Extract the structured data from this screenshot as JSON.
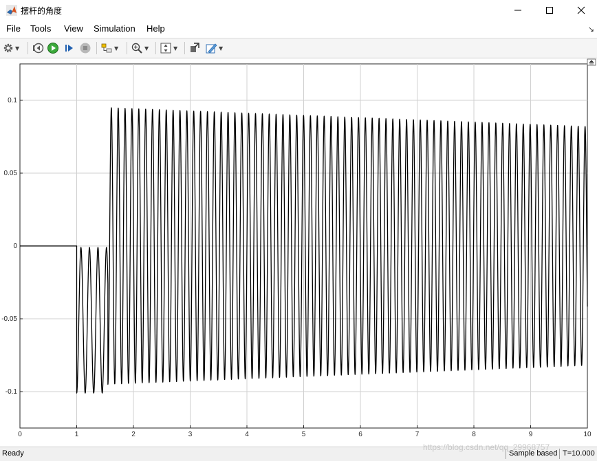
{
  "window": {
    "title": "摆杆的角度"
  },
  "menu": {
    "items": [
      "File",
      "Tools",
      "View",
      "Simulation",
      "Help"
    ]
  },
  "toolbar": {
    "buttons": [
      "gear-icon",
      "step-back-icon",
      "run-icon",
      "step-forward-icon",
      "stop-icon",
      "highlight-block-icon",
      "zoom-in-icon",
      "autoscale-icon",
      "signal-selector-icon",
      "style-icon"
    ]
  },
  "status": {
    "left": "Ready",
    "mode": "Sample based",
    "time": "T=10.000"
  },
  "watermark": "https://blog.csdn.net/qq_29968757",
  "colors": {
    "trace": "#000000",
    "grid": "#d0d0d0",
    "accent_run": "#2e9e2e"
  },
  "chart_data": {
    "type": "line",
    "title": "",
    "xlabel": "",
    "ylabel": "",
    "xlim": [
      0,
      10
    ],
    "ylim": [
      -0.125,
      0.125
    ],
    "x_ticks": [
      0,
      1,
      2,
      3,
      4,
      5,
      6,
      7,
      8,
      9,
      10
    ],
    "y_ticks": [
      -0.1,
      -0.05,
      0,
      0.05,
      0.1
    ],
    "y_tick_labels": [
      "-0.1",
      "-0.05",
      "0",
      "0.05",
      "0.1"
    ],
    "grid": true,
    "series": [
      {
        "name": "",
        "color": "#000000",
        "phases": [
          {
            "t_start": 0,
            "t_end": 1.0,
            "behavior": "flat",
            "value": 0
          },
          {
            "t_start": 1.0,
            "t_end": 1.55,
            "behavior": "oscillation",
            "min": -0.101,
            "max": -0.001,
            "period": 0.15
          },
          {
            "t_start": 1.55,
            "t_end": 10.0,
            "behavior": "oscillation",
            "amplitude_start": 0.095,
            "amplitude_end": 0.082,
            "period": 0.121
          }
        ]
      }
    ]
  }
}
